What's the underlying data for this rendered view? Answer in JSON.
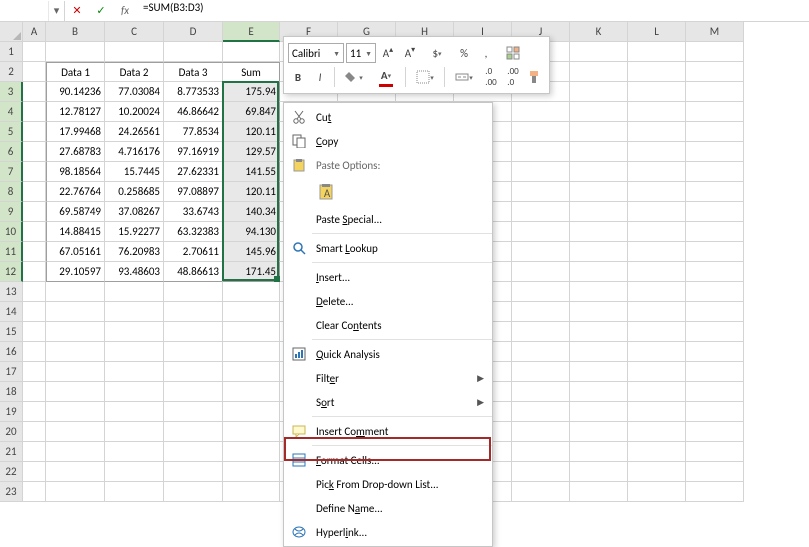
{
  "formula_bar": {
    "formula": "=SUM(B3:D3)",
    "name_box": ""
  },
  "columns": [
    "A",
    "B",
    "C",
    "D",
    "E",
    "F",
    "G",
    "H",
    "I",
    "J",
    "K",
    "L",
    "M"
  ],
  "rows_visible": 23,
  "selected_col_idx": 4,
  "selected_rows": [
    3,
    4,
    5,
    6,
    7,
    8,
    9,
    10,
    11,
    12
  ],
  "headers": {
    "b": "Data 1",
    "c": "Data 2",
    "d": "Data 3",
    "e": "Sum"
  },
  "table": [
    {
      "b": "90.14236",
      "c": "77.03084",
      "d": "8.773533",
      "e": "175.94"
    },
    {
      "b": "12.78127",
      "c": "10.20024",
      "d": "46.86642",
      "e": "69.847"
    },
    {
      "b": "17.99468",
      "c": "24.26561",
      "d": "77.8534",
      "e": "120.11"
    },
    {
      "b": "27.68783",
      "c": "4.716176",
      "d": "97.16919",
      "e": "129.57"
    },
    {
      "b": "98.18564",
      "c": "15.7445",
      "d": "27.62331",
      "e": "141.55"
    },
    {
      "b": "22.76764",
      "c": "0.258685",
      "d": "97.08897",
      "e": "120.11"
    },
    {
      "b": "69.58749",
      "c": "37.08267",
      "d": "33.6743",
      "e": "140.34"
    },
    {
      "b": "14.88415",
      "c": "15.92277",
      "d": "63.32383",
      "e": "94.130"
    },
    {
      "b": "67.05161",
      "c": "76.20983",
      "d": "2.70611",
      "e": "145.96"
    },
    {
      "b": "29.10597",
      "c": "93.48603",
      "d": "48.86613",
      "e": "171.45"
    }
  ],
  "mini_toolbar": {
    "font_name": "Calibri",
    "font_size": "11",
    "buttons": {
      "grow_font": "A",
      "shrink_font": "A",
      "currency": "$",
      "percent": "%",
      "comma": ",",
      "bold": "B",
      "italic": "I"
    }
  },
  "context_menu": {
    "cut": "Cut",
    "copy": "Copy",
    "paste_options_heading": "Paste Options:",
    "paste_special": "Paste Special...",
    "smart_lookup": "Smart Lookup",
    "insert": "Insert...",
    "delete": "Delete...",
    "clear": "Clear Contents",
    "quick_analysis": "Quick Analysis",
    "filter": "Filter",
    "sort": "Sort",
    "insert_comment": "Insert Comment",
    "format_cells": "Format Cells...",
    "pick_list": "Pick From Drop-down List...",
    "define_name": "Define Name...",
    "hyperlink": "Hyperlink..."
  }
}
